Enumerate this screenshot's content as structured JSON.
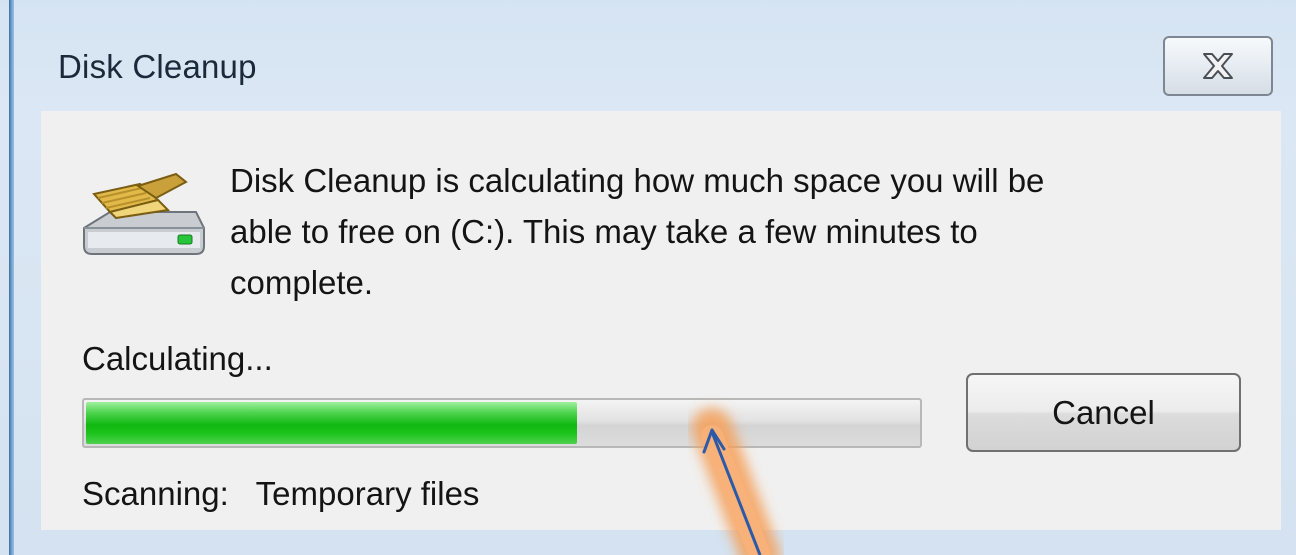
{
  "window": {
    "title": "Disk Cleanup",
    "close_icon": "close-x-icon"
  },
  "dialog": {
    "icon": "disk-cleanup-icon",
    "message": "Disk Cleanup is calculating how much space you will be\nable to free on  (C:). This may take a few minutes to\ncomplete.",
    "status_label": "Calculating...",
    "progress_fraction": 0.59,
    "scanning_text": "Scanning:   Temporary files",
    "cancel_label": "Cancel"
  },
  "colors": {
    "progress_green": "#10b710",
    "annotation_glow": "#f5a05a",
    "annotation_arrow": "#2c5aa8"
  }
}
